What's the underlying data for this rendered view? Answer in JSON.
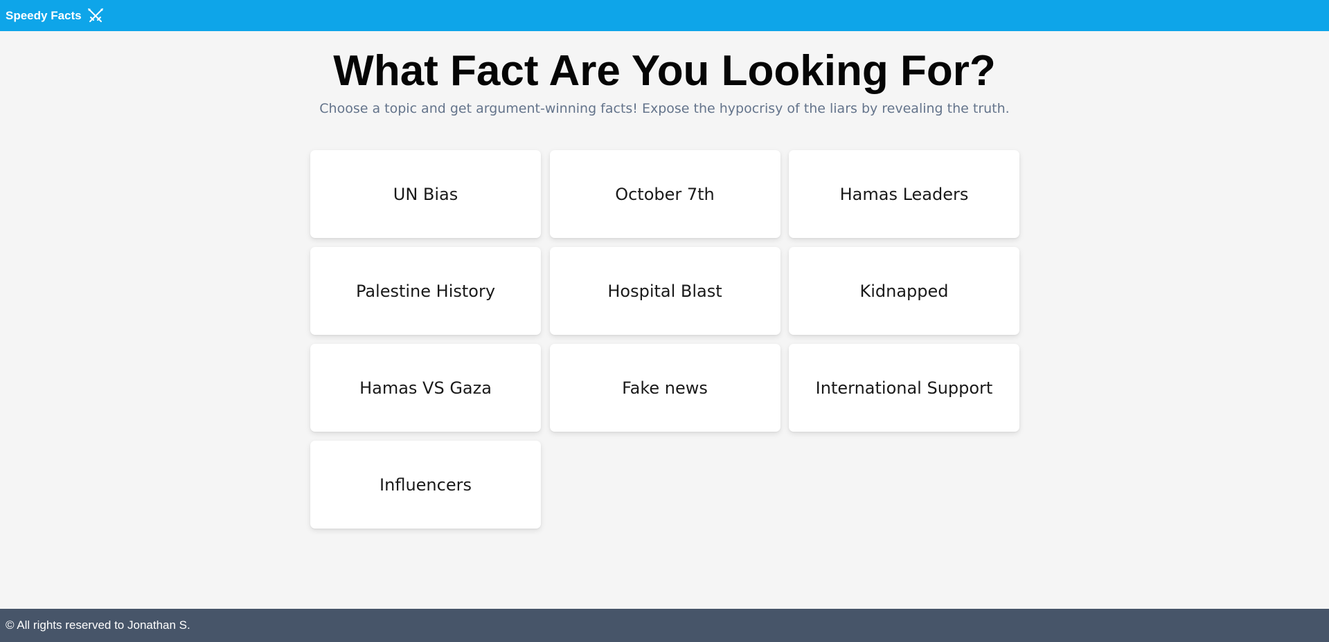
{
  "header": {
    "brand": "Speedy Facts",
    "brand_icon": "crossed-swords-icon",
    "background_color": "#0ea5e9"
  },
  "hero": {
    "title": "What Fact Are You Looking For?",
    "subtitle": "Choose a topic and get argument-winning facts! Expose the hypocrisy of the liars by revealing the truth."
  },
  "topics": [
    {
      "label": "UN Bias"
    },
    {
      "label": "October 7th"
    },
    {
      "label": "Hamas Leaders"
    },
    {
      "label": "Palestine History"
    },
    {
      "label": "Hospital Blast"
    },
    {
      "label": "Kidnapped"
    },
    {
      "label": "Hamas VS Gaza"
    },
    {
      "label": "Fake news"
    },
    {
      "label": "International Support"
    },
    {
      "label": "Influencers"
    }
  ],
  "footer": {
    "text": "© All rights reserved to Jonathan S.",
    "background_color": "#475569"
  }
}
